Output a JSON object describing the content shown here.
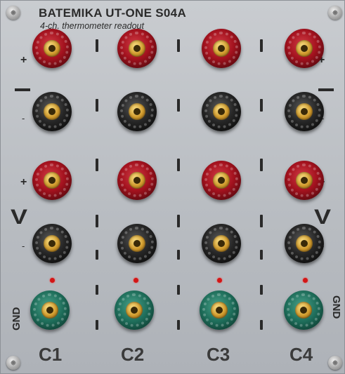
{
  "panel": {
    "title": "BATEMIKA UT-ONE S04A",
    "subtitle": "4-ch. thermometer readout"
  },
  "labels": {
    "plus_top_left": "+",
    "plus_top_right": "+",
    "minus_mid_left": "-",
    "minus_mid_right": "-",
    "plus_v_left": "+",
    "plus_v_right": "+",
    "minus_v_left": "-",
    "minus_v_right": "-",
    "v_left": "V",
    "v_right": "V",
    "gnd_left": "GND",
    "gnd_right": "GND"
  },
  "channels": [
    "C1",
    "C2",
    "C3",
    "C4"
  ],
  "colors": {
    "red_jack": "#a3121e",
    "black_jack": "#262626",
    "green_jack": "#1d6b58",
    "led": "#d21616",
    "panel": "#bfc3c8"
  },
  "jack_rows": [
    "red",
    "black",
    "red",
    "black",
    "green"
  ]
}
